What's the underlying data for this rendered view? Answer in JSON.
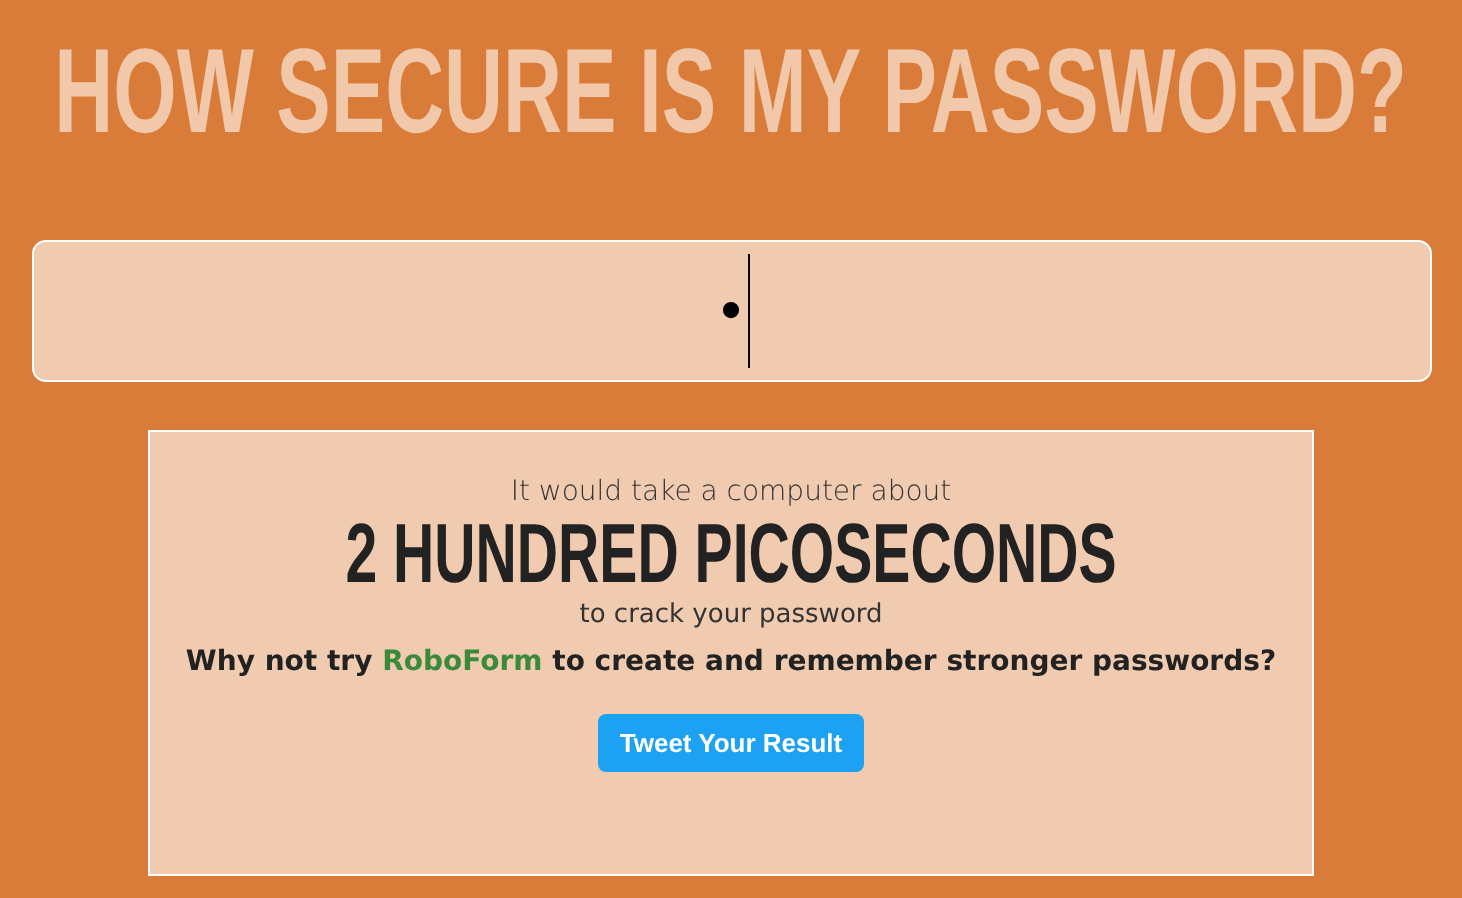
{
  "title": "HOW SECURE IS MY PASSWORD?",
  "password_field": {
    "value": "•"
  },
  "result": {
    "intro": "It would take a computer about",
    "time": "2 HUNDRED PICOSECONDS",
    "outro": "to crack your password",
    "link": "RoboForm",
    "suggestion_before": "Why not try",
    "suggestion_after": "to create and remember stronger passwords?",
    "button": "Tweet Your Result"
  }
}
